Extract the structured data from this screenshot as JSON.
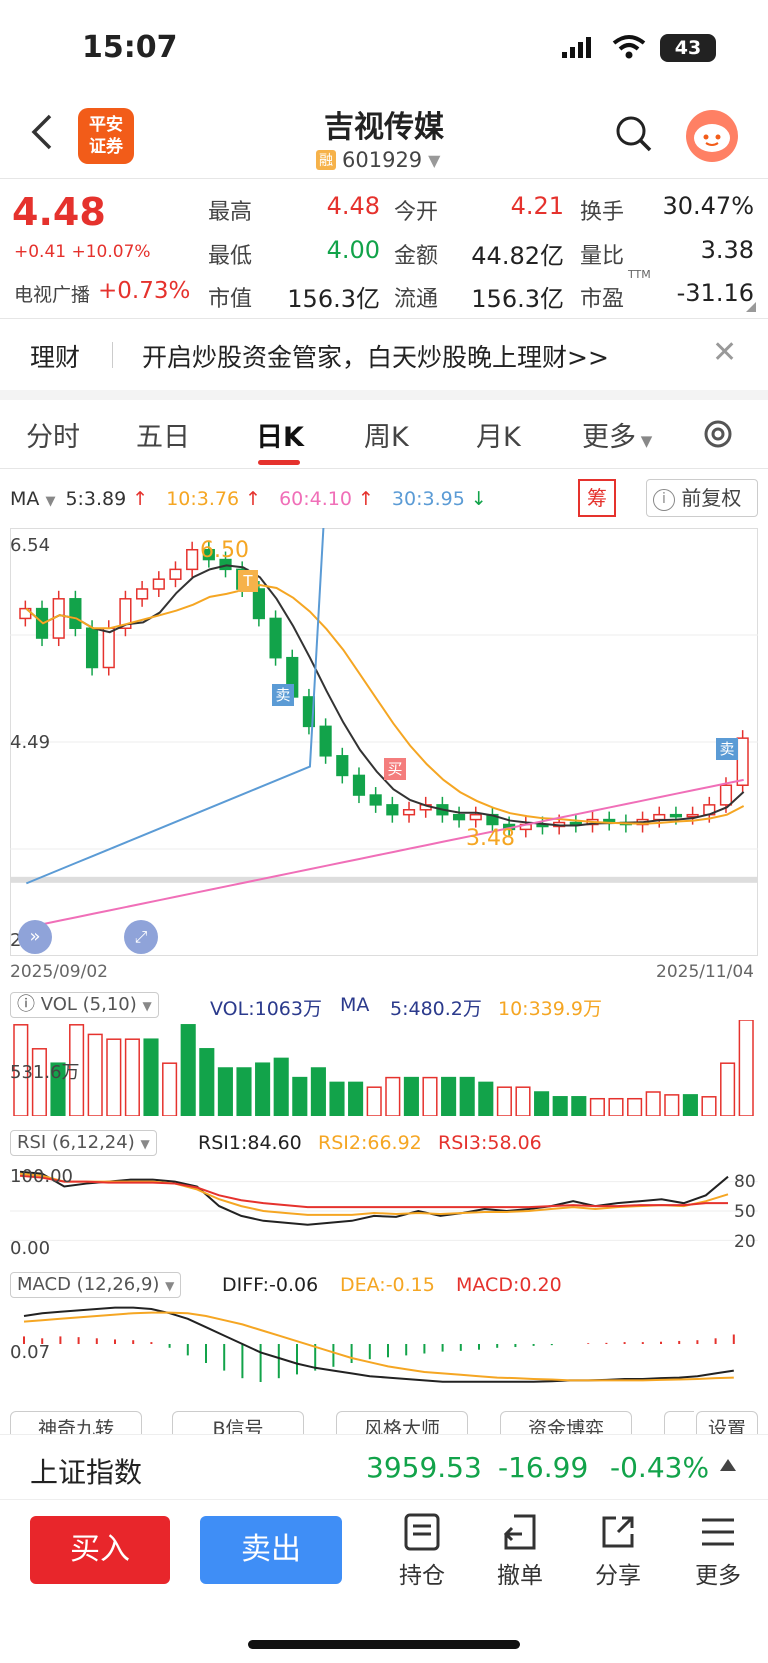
{
  "status_bar": {
    "time": "15:07",
    "battery": "43"
  },
  "header": {
    "back_icon": "back-arrow-icon",
    "logo_lines": [
      "平安",
      "证券"
    ],
    "stock_name": "吉视传媒",
    "rong_badge": "融",
    "code": "601929",
    "search_icon": "search-icon",
    "avatar_icon": "assistant-avatar-icon"
  },
  "quote": {
    "price": "4.48",
    "change": "+0.41 +10.07%",
    "sector_name": "电视广播",
    "sector_change": "+0.73%",
    "fields": [
      {
        "label": "最高",
        "value": "4.48"
      },
      {
        "label": "今开",
        "value": "4.21"
      },
      {
        "label": "换手",
        "value": "30.47%"
      },
      {
        "label": "最低",
        "value": "4.00"
      },
      {
        "label": "金额",
        "value": "44.82亿"
      },
      {
        "label": "量比",
        "value": "3.38"
      },
      {
        "label": "市值",
        "value": "156.3亿"
      },
      {
        "label": "流通",
        "value": "156.3亿"
      },
      {
        "label": "市盈",
        "value": "-31.16"
      }
    ],
    "ttm": "TTM"
  },
  "banner": {
    "label": "理财",
    "text": "开启炒股资金管家，白天炒股晚上理财>>"
  },
  "tabs": [
    "分时",
    "五日",
    "日K",
    "周K",
    "月K",
    "更多"
  ],
  "active_tab": "日K",
  "ma_row": {
    "label": "MA",
    "items": [
      {
        "text": "5:3.89",
        "color": "#333333",
        "arrow": "↑"
      },
      {
        "text": "10:3.76",
        "color": "#f5a623",
        "arrow": "↑"
      },
      {
        "text": "60:4.10",
        "color": "#f06fb8",
        "arrow": "↑"
      },
      {
        "text": "30:3.95",
        "color": "#5b9bd5",
        "arrow": "↓"
      }
    ],
    "chip_label": "筹",
    "adjust_label": "前复权"
  },
  "kline": {
    "y_top": "6.54",
    "y_mid": "4.49",
    "y_bottom": "2.44",
    "high_mark": "6.50",
    "low_mark": "3.48",
    "date_start": "2025/09/02",
    "date_end": "2025/11/04",
    "signals": [
      "T",
      "卖",
      "买",
      "卖"
    ]
  },
  "vol_row": {
    "label": "VOL (5,10)",
    "vol": "VOL:1063万",
    "ma_label": "MA",
    "ma5": "5:480.2万",
    "ma10": "10:339.9万",
    "axis": "531.6万"
  },
  "rsi_row": {
    "label": "RSI (6,12,24)",
    "rsi1": "RSI1:84.60",
    "rsi2": "RSI2:66.92",
    "rsi3": "RSI3:58.06",
    "top": "100.00",
    "bottom": "0.00",
    "r80": "80",
    "r50": "50",
    "r20": "20"
  },
  "macd_row": {
    "label": "MACD (12,26,9)",
    "diff": "DIFF:-0.06",
    "dea": "DEA:-0.15",
    "macd": "MACD:0.20",
    "axis": "0.07"
  },
  "tool_buttons": [
    "神奇九转",
    "B信号",
    "风格大师",
    "资金博弈",
    "设置"
  ],
  "index_bar": {
    "name": "上证指数",
    "value": "3959.53",
    "change": "-16.99",
    "pct": "-0.43%"
  },
  "bottom_bar": {
    "buy": "买入",
    "sell": "卖出",
    "items": [
      "持仓",
      "撤单",
      "分享",
      "更多"
    ]
  },
  "colors": {
    "up": "#e5322d",
    "down": "#12a34a",
    "ma5": "#333333",
    "ma10": "#f5a623",
    "ma30": "#5b9bd5",
    "ma60": "#f06fb8"
  }
}
